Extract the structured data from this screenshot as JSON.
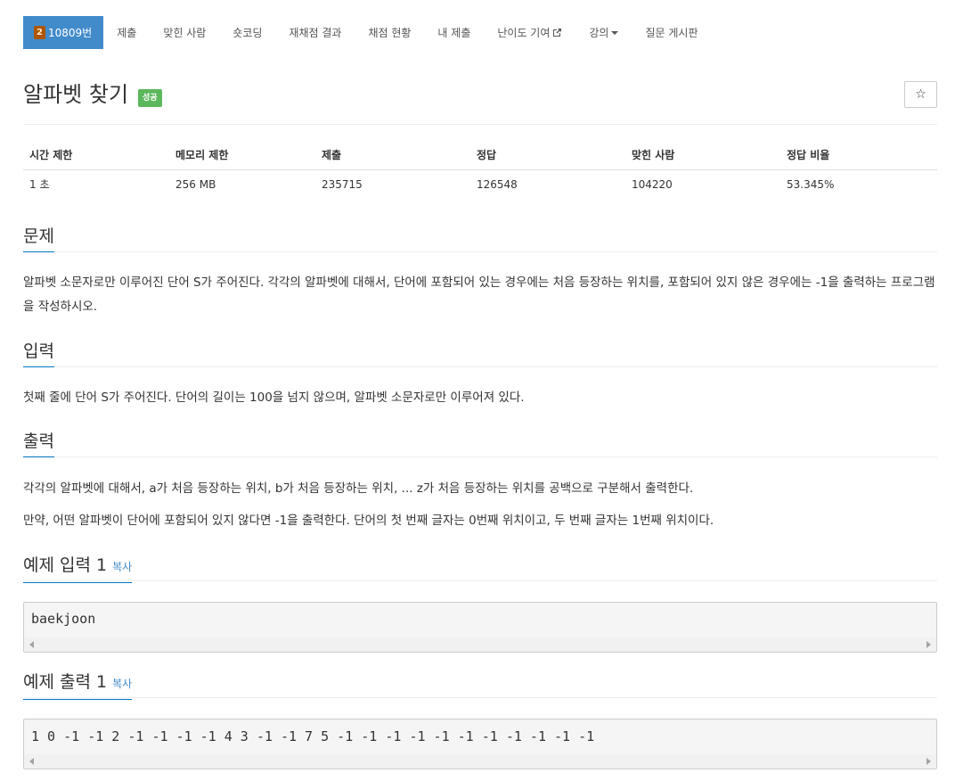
{
  "nav": {
    "problem_id": "10809번",
    "tier_level": "2",
    "items": [
      "제출",
      "맞힌 사람",
      "숏코딩",
      "재채점 결과",
      "채점 현황",
      "내 제출",
      "난이도 기여",
      "강의",
      "질문 게시판"
    ]
  },
  "header": {
    "title": "알파벳 찾기",
    "status": "성공",
    "star": "☆"
  },
  "info": {
    "headers": [
      "시간 제한",
      "메모리 제한",
      "제출",
      "정답",
      "맞힌 사람",
      "정답 비율"
    ],
    "values": [
      "1 초",
      "256 MB",
      "235715",
      "126548",
      "104220",
      "53.345%"
    ]
  },
  "problem": {
    "title": "문제",
    "text": "알파벳 소문자로만 이루어진 단어 S가 주어진다. 각각의 알파벳에 대해서, 단어에 포함되어 있는 경우에는 처음 등장하는 위치를, 포함되어 있지 않은 경우에는 -1을 출력하는 프로그램을 작성하시오."
  },
  "input": {
    "title": "입력",
    "text": "첫째 줄에 단어 S가 주어진다. 단어의 길이는 100을 넘지 않으며, 알파벳 소문자로만 이루어져 있다."
  },
  "output": {
    "title": "출력",
    "text1": "각각의 알파벳에 대해서, a가 처음 등장하는 위치, b가 처음 등장하는 위치, ... z가 처음 등장하는 위치를 공백으로 구분해서 출력한다.",
    "text2": "만약, 어떤 알파벳이 단어에 포함되어 있지 않다면 -1을 출력한다. 단어의 첫 번째 글자는 0번째 위치이고, 두 번째 글자는 1번째 위치이다."
  },
  "sample_input": {
    "title": "예제 입력 1",
    "copy": "복사",
    "content": "baekjoon"
  },
  "sample_output": {
    "title": "예제 출력 1",
    "copy": "복사",
    "content": "1 0 -1 -1 2 -1 -1 -1 -1 4 3 -1 -1 7 5 -1 -1 -1 -1 -1 -1 -1 -1 -1 -1 -1"
  },
  "colors": {
    "nav_active": "#428bca",
    "success": "#5cb85c",
    "section_underline": "#0076c0",
    "link": "#428bca"
  }
}
